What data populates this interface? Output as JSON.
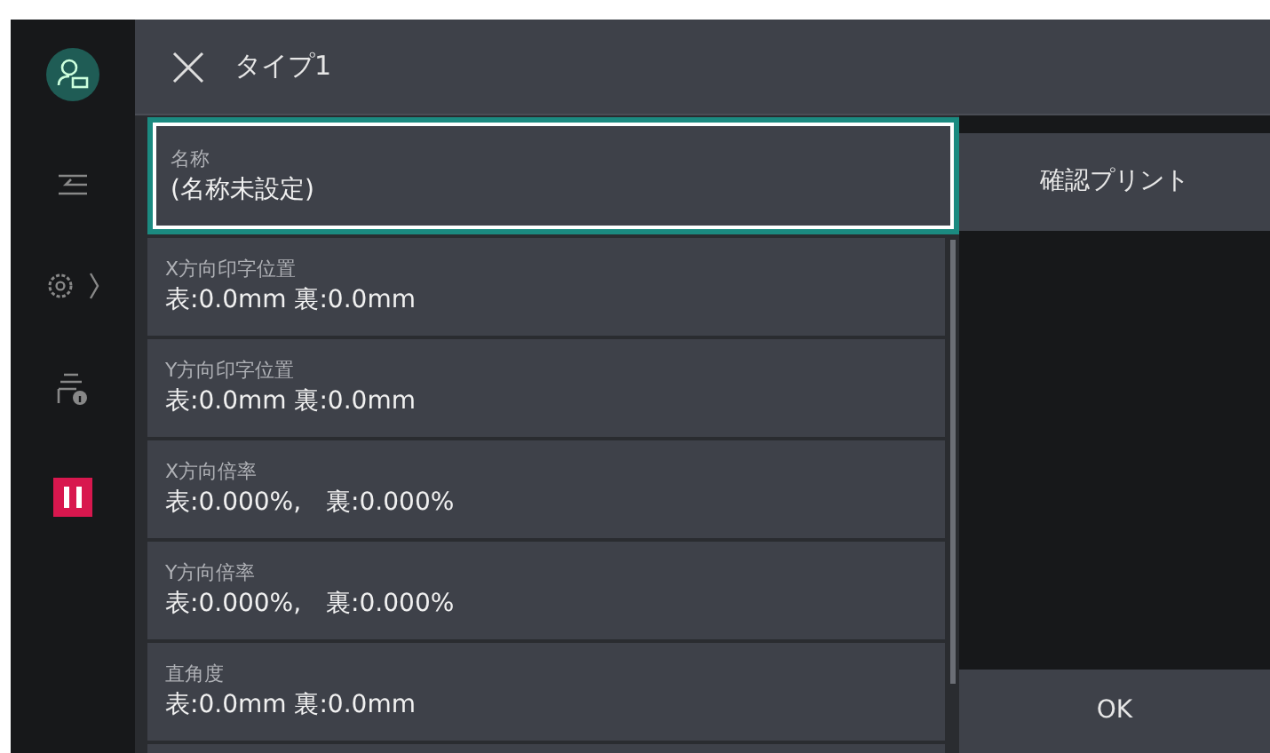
{
  "header": {
    "title": "タイプ1"
  },
  "items": [
    {
      "label": "名称",
      "value": "(名称未設定)",
      "selected": true
    },
    {
      "label": "X方向印字位置",
      "value": "表:0.0mm 裏:0.0mm",
      "selected": false
    },
    {
      "label": "Y方向印字位置",
      "value": "表:0.0mm 裏:0.0mm",
      "selected": false
    },
    {
      "label": "X方向倍率",
      "value": "表:0.000%,　裏:0.000%",
      "selected": false
    },
    {
      "label": "Y方向倍率",
      "value": "表:0.000%,　裏:0.000%",
      "selected": false
    },
    {
      "label": "直角度",
      "value": "表:0.0mm 裏:0.0mm",
      "selected": false
    }
  ],
  "buttons": {
    "proof_print": "確認プリント",
    "ok": "OK"
  }
}
